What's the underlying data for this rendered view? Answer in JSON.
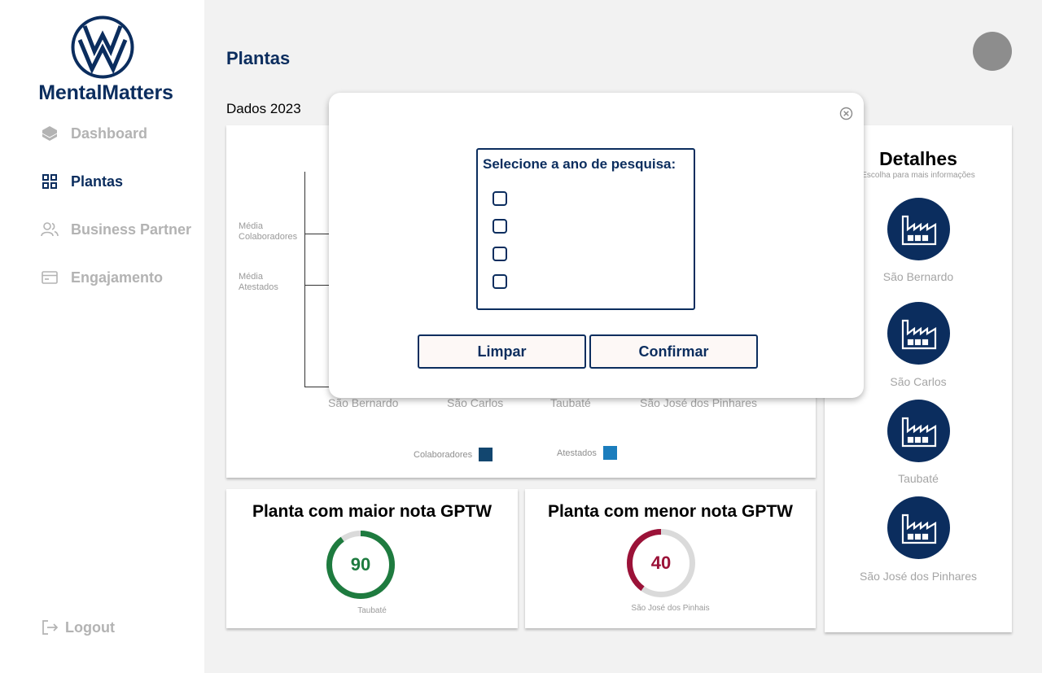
{
  "brand": {
    "name": "MentalMatters",
    "logo_icon": "vw-logo-icon",
    "primary_color": "#0b2d5e"
  },
  "sidebar": {
    "items": [
      {
        "label": "Dashboard",
        "icon": "layers-icon",
        "active": false
      },
      {
        "label": "Plantas",
        "icon": "grid-icon",
        "active": true
      },
      {
        "label": "Business Partner",
        "icon": "users-icon",
        "active": false
      },
      {
        "label": "Engajamento",
        "icon": "card-icon",
        "active": false
      }
    ],
    "logout_label": "Logout"
  },
  "header": {
    "title": "Plantas",
    "subtitle": "Dados 2023"
  },
  "chart": {
    "y_labels": [
      "Média\nColaboradores",
      "Média\nAtestados"
    ],
    "x_labels": [
      "São Bernardo",
      "São Carlos",
      "Taubaté",
      "São José dos Pinhares"
    ],
    "legend": [
      {
        "label": "Colaboradores",
        "color": "#12466f"
      },
      {
        "label": "Atestados",
        "color": "#1b7dbd"
      }
    ]
  },
  "details": {
    "title": "Detalhes",
    "subtitle": "Escolha para mais informações",
    "plants": [
      {
        "name": "São Bernardo",
        "icon": "factory-icon"
      },
      {
        "name": "São Carlos",
        "icon": "factory-icon"
      },
      {
        "name": "Taubaté",
        "icon": "factory-icon"
      },
      {
        "name": "São José dos Pinhares",
        "icon": "factory-icon"
      }
    ]
  },
  "gptw": {
    "best": {
      "title": "Planta com maior nota GPTW",
      "value": 90,
      "percent": 90,
      "plant": "Taubaté",
      "color": "#1e7b3f"
    },
    "worst": {
      "title": "Planta com menor nota GPTW",
      "value": 40,
      "percent": 40,
      "plant": "São José dos Pinhais",
      "color": "#9b1238"
    }
  },
  "modal": {
    "title": "Selecione a ano de pesquisa:",
    "options_count": 4,
    "clear_label": "Limpar",
    "confirm_label": "Confirmar"
  }
}
